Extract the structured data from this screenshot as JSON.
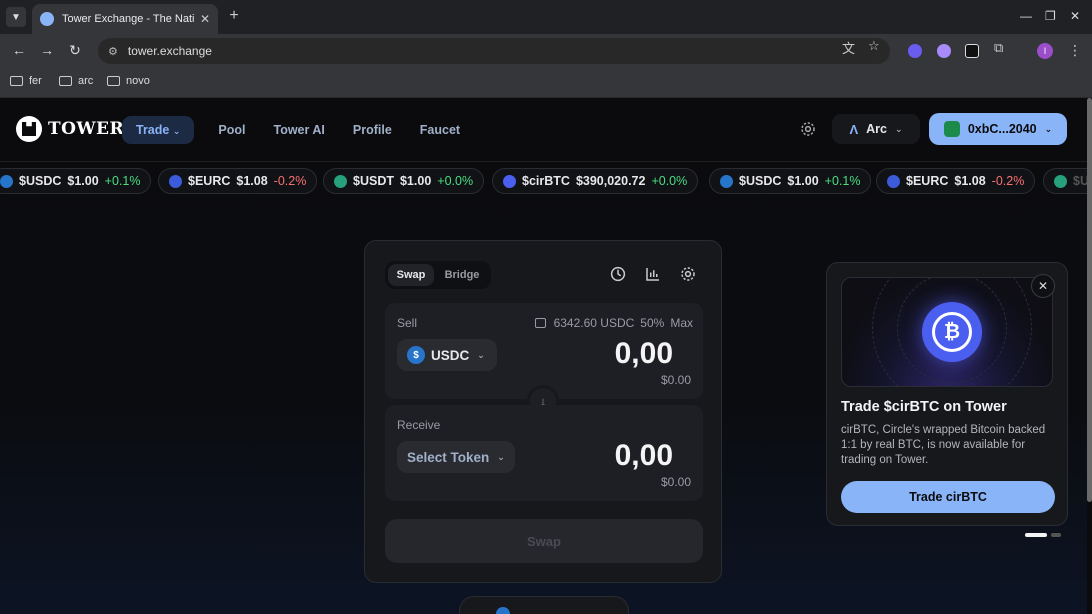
{
  "browser": {
    "tab_title": "Tower Exchange - The Native",
    "url": "tower.exchange",
    "bookmarks": [
      "fer",
      "arc",
      "novo"
    ],
    "profile_initial": "I"
  },
  "header": {
    "logo_text": "TOWER",
    "nav": [
      "Trade",
      "Pool",
      "Tower AI",
      "Profile",
      "Faucet"
    ],
    "network": "Arc",
    "wallet": "0xbC...2040",
    "accent": "#8ab4f8"
  },
  "ticker": [
    {
      "symbol": "$USDC",
      "price": "$1.00",
      "change": "+0.1%",
      "dir": "up",
      "color": "#2775ca"
    },
    {
      "symbol": "$EURC",
      "price": "$1.08",
      "change": "-0.2%",
      "dir": "down",
      "color": "#3b5bdb"
    },
    {
      "symbol": "$USDT",
      "price": "$1.00",
      "change": "+0.0%",
      "dir": "up",
      "color": "#26a17b"
    },
    {
      "symbol": "$cirBTC",
      "price": "$390,020.72",
      "change": "+0.0%",
      "dir": "up",
      "color": "#4a5ff0"
    },
    {
      "symbol": "$USDC",
      "price": "$1.00",
      "change": "+0.1%",
      "dir": "up",
      "color": "#2775ca"
    },
    {
      "symbol": "$EURC",
      "price": "$1.08",
      "change": "-0.2%",
      "dir": "down",
      "color": "#3b5bdb"
    },
    {
      "symbol": "$U",
      "price": "",
      "change": "",
      "dir": "up",
      "color": "#26a17b"
    }
  ],
  "swap": {
    "tabs": [
      "Swap",
      "Bridge"
    ],
    "sell": {
      "label": "Sell",
      "balance": "6342.60 USDC",
      "half": "50%",
      "max": "Max",
      "token": "USDC",
      "amount": "0,00",
      "usd": "$0.00"
    },
    "receive": {
      "label": "Receive",
      "token": "Select Token",
      "amount": "0,00",
      "usd": "$0.00"
    },
    "button": "Swap"
  },
  "promo": {
    "title": "Trade $cirBTC on Tower",
    "description": "cirBTC, Circle's wrapped Bitcoin backed 1:1 by real BTC, is now available for trading on Tower.",
    "button": "Trade cirBTC",
    "coin_symbol": "₿"
  }
}
